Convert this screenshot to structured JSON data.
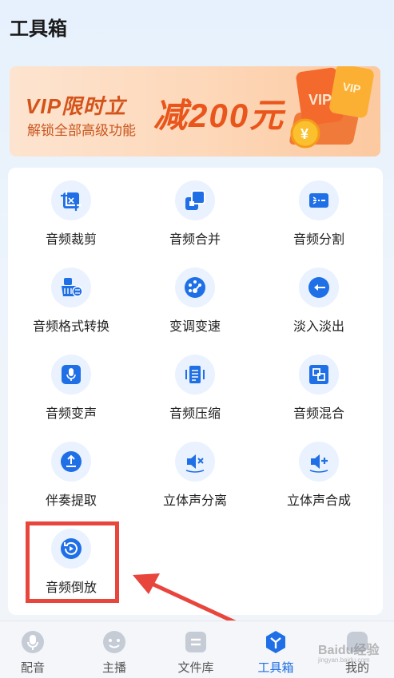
{
  "header": {
    "title": "工具箱"
  },
  "banner": {
    "line1": "VIP限时立",
    "line2": "解锁全部高级功能",
    "big": "减200元",
    "badge1": "VIP",
    "badge2": "VIP",
    "coin": "¥"
  },
  "tools": [
    {
      "label": "音频裁剪",
      "icon": "crop-icon"
    },
    {
      "label": "音频合并",
      "icon": "merge-icon"
    },
    {
      "label": "音频分割",
      "icon": "split-icon"
    },
    {
      "label": "音频格式转换",
      "icon": "format-convert-icon"
    },
    {
      "label": "变调变速",
      "icon": "speed-dial-icon"
    },
    {
      "label": "淡入淡出",
      "icon": "fade-icon"
    },
    {
      "label": "音频变声",
      "icon": "microphone-icon"
    },
    {
      "label": "音频压缩",
      "icon": "compress-icon"
    },
    {
      "label": "音频混合",
      "icon": "mix-icon"
    },
    {
      "label": "伴奏提取",
      "icon": "extract-icon"
    },
    {
      "label": "立体声分离",
      "icon": "speaker-split-icon"
    },
    {
      "label": "立体声合成",
      "icon": "speaker-merge-icon"
    },
    {
      "label": "音频倒放",
      "icon": "reverse-play-icon"
    }
  ],
  "nav": [
    {
      "label": "配音",
      "icon": "mic-nav-icon"
    },
    {
      "label": "主播",
      "icon": "face-nav-icon"
    },
    {
      "label": "文件库",
      "icon": "folder-nav-icon"
    },
    {
      "label": "工具箱",
      "icon": "toolbox-nav-icon"
    },
    {
      "label": "我的",
      "icon": "profile-nav-icon"
    }
  ],
  "watermark": {
    "text": "Baidu经验",
    "sub": "jingyan.baidu.com"
  },
  "colors": {
    "accent": "#1f6fe6",
    "icon_bg": "#e9f2fe",
    "highlight": "#e8453c",
    "banner_text": "#e9551b"
  }
}
